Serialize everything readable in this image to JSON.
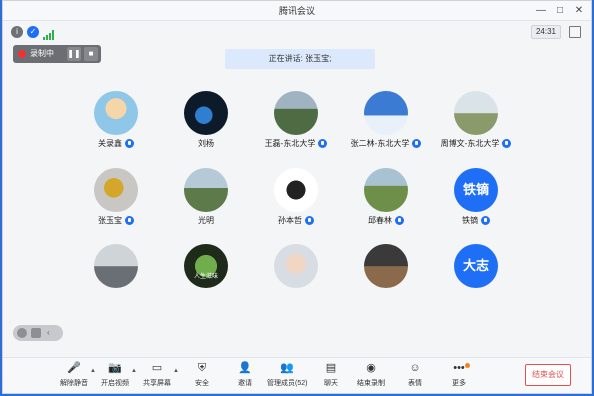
{
  "window": {
    "title": "腾讯会议"
  },
  "infobar": {
    "timer": "24:31"
  },
  "recording": {
    "label": "录制中"
  },
  "speaking": {
    "text": "正在讲话: 张玉宝;"
  },
  "participants": [
    {
      "name": "关录鑫",
      "avatar": "cartoon-avatar",
      "mic": true
    },
    {
      "name": "刘杨",
      "avatar": "earth-avatar",
      "mic": false
    },
    {
      "name": "王磊-东北大学",
      "avatar": "trees-avatar",
      "mic": true
    },
    {
      "name": "张二林-东北大学",
      "avatar": "sky-avatar",
      "mic": true
    },
    {
      "name": "周博文-东北大学",
      "avatar": "couple-avatar",
      "mic": true
    },
    {
      "name": "张玉宝",
      "avatar": "coin-avatar",
      "mic": true
    },
    {
      "name": "光明",
      "avatar": "mountain-avatar",
      "mic": false
    },
    {
      "name": "孙本哲",
      "avatar": "crown-avatar",
      "mic": true
    },
    {
      "name": "邱春林",
      "avatar": "field-avatar",
      "mic": true
    },
    {
      "name": "铁镝",
      "avatar_text": "铁镝",
      "mic": true
    },
    {
      "name": "",
      "avatar": "person-avatar",
      "mic": false
    },
    {
      "name": "",
      "avatar": "food-avatar",
      "avatar_caption": "人生滋味",
      "mic": false
    },
    {
      "name": "",
      "avatar": "girl-avatar",
      "mic": false
    },
    {
      "name": "",
      "avatar": "fire-avatar",
      "mic": false
    },
    {
      "name": "",
      "avatar_text": "大志",
      "mic": false
    }
  ],
  "toolbar": {
    "items": [
      {
        "label": "解除静音",
        "icon": "mic-muted-icon"
      },
      {
        "label": "开启视频",
        "icon": "camera-off-icon"
      },
      {
        "label": "共享屏幕",
        "icon": "share-screen-icon"
      },
      {
        "label": "安全",
        "icon": "shield-icon"
      },
      {
        "label": "邀请",
        "icon": "invite-icon"
      },
      {
        "label": "管理成员(52)",
        "icon": "members-icon"
      },
      {
        "label": "聊天",
        "icon": "chat-icon"
      },
      {
        "label": "结束录制",
        "icon": "stop-record-icon"
      },
      {
        "label": "表情",
        "icon": "emoji-icon"
      },
      {
        "label": "更多",
        "icon": "more-icon"
      }
    ],
    "end_button": "结束会议"
  }
}
